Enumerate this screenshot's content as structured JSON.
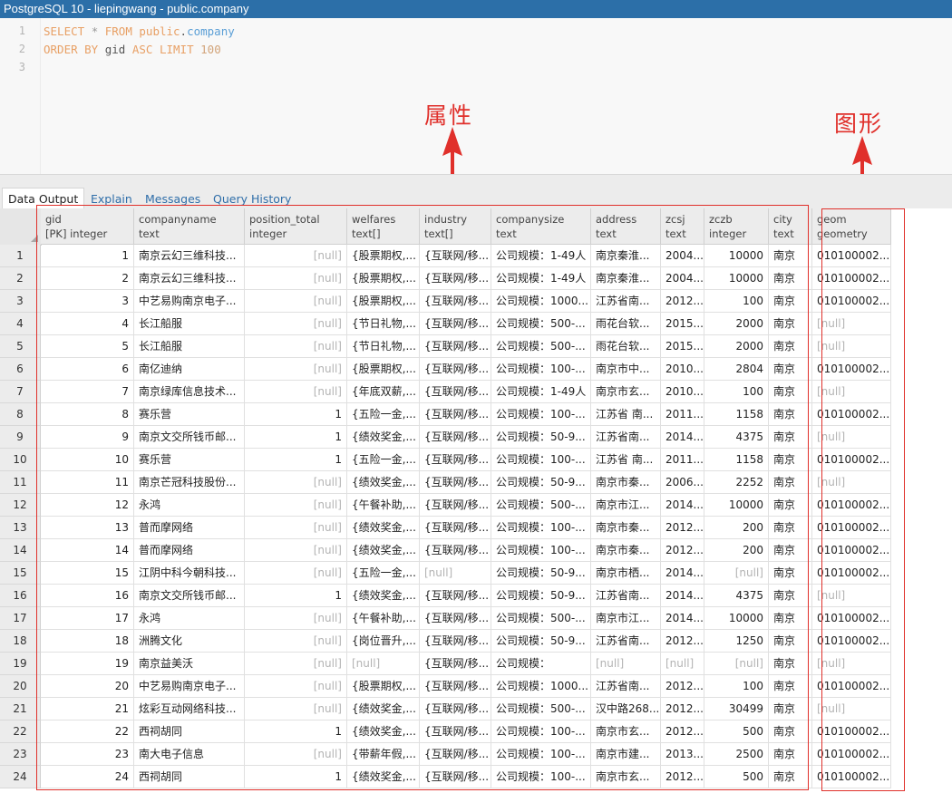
{
  "window": {
    "title": "PostgreSQL 10 - liepingwang - public.company"
  },
  "editor": {
    "line_numbers": [
      "1",
      "2",
      "3"
    ],
    "line1": {
      "kw1": "SELECT",
      "star": "*",
      "kw2": "FROM",
      "schema": "public",
      "dot": ".",
      "table": "company"
    },
    "line2": {
      "kw1": "ORDER BY",
      "col": "gid",
      "kw2": "ASC",
      "kw3": "LIMIT",
      "num": "100"
    }
  },
  "annotations": {
    "attributes": "属性",
    "geometry": "图形"
  },
  "colors": {
    "annotation": "#e0302b",
    "titlebar": "#2c6fa8",
    "keyword": "#e8a065",
    "identifier": "#5b9fd6"
  },
  "tabs": [
    {
      "label": "Data Output",
      "active": true
    },
    {
      "label": "Explain",
      "active": false
    },
    {
      "label": "Messages",
      "active": false
    },
    {
      "label": "Query History",
      "active": false
    }
  ],
  "columns": [
    {
      "name": "gid",
      "type": "[PK] integer"
    },
    {
      "name": "companyname",
      "type": "text"
    },
    {
      "name": "position_total",
      "type": "integer"
    },
    {
      "name": "welfares",
      "type": "text[]"
    },
    {
      "name": "industry",
      "type": "text[]"
    },
    {
      "name": "companysize",
      "type": "text"
    },
    {
      "name": "address",
      "type": "text"
    },
    {
      "name": "zcsj",
      "type": "text"
    },
    {
      "name": "zczb",
      "type": "integer"
    },
    {
      "name": "city",
      "type": "text"
    },
    {
      "name": "geom",
      "type": "geometry"
    }
  ],
  "rows": [
    [
      "1",
      "1",
      "南京云幻三维科技...",
      "[null]",
      "{股票期权,...",
      "{互联网/移...",
      "公司规模：1-49人",
      "南京秦淮...",
      "2004...",
      "10000",
      "南京",
      "010100002..."
    ],
    [
      "2",
      "2",
      "南京云幻三维科技...",
      "[null]",
      "{股票期权,...",
      "{互联网/移...",
      "公司规模：1-49人",
      "南京秦淮...",
      "2004...",
      "10000",
      "南京",
      "010100002..."
    ],
    [
      "3",
      "3",
      "中艺易购南京电子...",
      "[null]",
      "{股票期权,...",
      "{互联网/移...",
      "公司规模：1000...",
      "江苏省南...",
      "2012...",
      "100",
      "南京",
      "010100002..."
    ],
    [
      "4",
      "4",
      "长江船服",
      "[null]",
      "{节日礼物,...",
      "{互联网/移...",
      "公司规模：500-...",
      "雨花台软...",
      "2015...",
      "2000",
      "南京",
      "[null]"
    ],
    [
      "5",
      "5",
      "长江船服",
      "[null]",
      "{节日礼物,...",
      "{互联网/移...",
      "公司规模：500-...",
      "雨花台软...",
      "2015...",
      "2000",
      "南京",
      "[null]"
    ],
    [
      "6",
      "6",
      "南亿迪纳",
      "[null]",
      "{股票期权,...",
      "{互联网/移...",
      "公司规模：100-...",
      "南京市中...",
      "2010...",
      "2804",
      "南京",
      "010100002..."
    ],
    [
      "7",
      "7",
      "南京绿库信息技术...",
      "[null]",
      "{年底双薪,...",
      "{互联网/移...",
      "公司规模：1-49人",
      "南京市玄...",
      "2010...",
      "100",
      "南京",
      "[null]"
    ],
    [
      "8",
      "8",
      "赛乐营",
      "1",
      "{五险一金,...",
      "{互联网/移...",
      "公司规模：100-...",
      "江苏省 南...",
      "2011...",
      "1158",
      "南京",
      "010100002..."
    ],
    [
      "9",
      "9",
      "南京文交所钱币邮...",
      "1",
      "{绩效奖金,...",
      "{互联网/移...",
      "公司规模：50-9...",
      "江苏省南...",
      "2014...",
      "4375",
      "南京",
      "[null]"
    ],
    [
      "10",
      "10",
      "赛乐营",
      "1",
      "{五险一金,...",
      "{互联网/移...",
      "公司规模：100-...",
      "江苏省 南...",
      "2011...",
      "1158",
      "南京",
      "010100002..."
    ],
    [
      "11",
      "11",
      "南京芒冠科技股份...",
      "[null]",
      "{绩效奖金,...",
      "{互联网/移...",
      "公司规模：50-9...",
      "南京市秦...",
      "2006...",
      "2252",
      "南京",
      "[null]"
    ],
    [
      "12",
      "12",
      "永鸿",
      "[null]",
      "{午餐补助,...",
      "{互联网/移...",
      "公司规模：500-...",
      "南京市江...",
      "2014...",
      "10000",
      "南京",
      "010100002..."
    ],
    [
      "13",
      "13",
      "普而摩网络",
      "[null]",
      "{绩效奖金,...",
      "{互联网/移...",
      "公司规模：100-...",
      "南京市秦...",
      "2012...",
      "200",
      "南京",
      "010100002..."
    ],
    [
      "14",
      "14",
      "普而摩网络",
      "[null]",
      "{绩效奖金,...",
      "{互联网/移...",
      "公司规模：100-...",
      "南京市秦...",
      "2012...",
      "200",
      "南京",
      "010100002..."
    ],
    [
      "15",
      "15",
      "江阴中科今朝科技...",
      "[null]",
      "{五险一金,...",
      "[null]",
      "公司规模：50-9...",
      "南京市栖...",
      "2014...",
      "[null]",
      "南京",
      "010100002..."
    ],
    [
      "16",
      "16",
      "南京文交所钱币邮...",
      "1",
      "{绩效奖金,...",
      "{互联网/移...",
      "公司规模：50-9...",
      "江苏省南...",
      "2014...",
      "4375",
      "南京",
      "[null]"
    ],
    [
      "17",
      "17",
      "永鸿",
      "[null]",
      "{午餐补助,...",
      "{互联网/移...",
      "公司规模：500-...",
      "南京市江...",
      "2014...",
      "10000",
      "南京",
      "010100002..."
    ],
    [
      "18",
      "18",
      "洲腾文化",
      "[null]",
      "{岗位晋升,...",
      "{互联网/移...",
      "公司规模：50-9...",
      "江苏省南...",
      "2012...",
      "1250",
      "南京",
      "010100002..."
    ],
    [
      "19",
      "19",
      "南京益美沃",
      "[null]",
      "[null]",
      "{互联网/移...",
      "公司规模：",
      "[null]",
      "[null]",
      "[null]",
      "南京",
      "[null]"
    ],
    [
      "20",
      "20",
      "中艺易购南京电子...",
      "[null]",
      "{股票期权,...",
      "{互联网/移...",
      "公司规模：1000...",
      "江苏省南...",
      "2012...",
      "100",
      "南京",
      "010100002..."
    ],
    [
      "21",
      "21",
      "炫彩互动网络科技...",
      "[null]",
      "{绩效奖金,...",
      "{互联网/移...",
      "公司规模：500-...",
      "汉中路268...",
      "2012...",
      "30499",
      "南京",
      "[null]"
    ],
    [
      "22",
      "22",
      "西祠胡同",
      "1",
      "{绩效奖金,...",
      "{互联网/移...",
      "公司规模：100-...",
      "南京市玄...",
      "2012...",
      "500",
      "南京",
      "010100002..."
    ],
    [
      "23",
      "23",
      "南大电子信息",
      "[null]",
      "{带薪年假,...",
      "{互联网/移...",
      "公司规模：100-...",
      "南京市建...",
      "2013...",
      "2500",
      "南京",
      "010100002..."
    ],
    [
      "24",
      "24",
      "西祠胡同",
      "1",
      "{绩效奖金,...",
      "{互联网/移...",
      "公司规模：100-...",
      "南京市玄...",
      "2012...",
      "500",
      "南京",
      "010100002..."
    ]
  ]
}
